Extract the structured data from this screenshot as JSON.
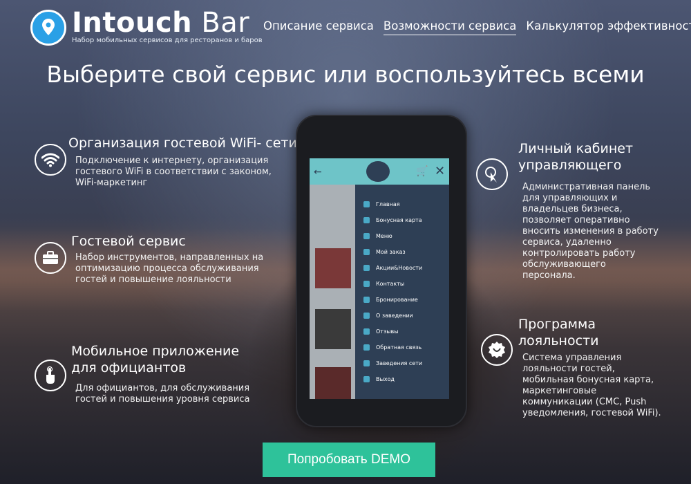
{
  "header": {
    "logo_bold": "Intouch",
    "logo_light": " Bar",
    "logo_subtitle": "Набор мобильных сервисов для ресторанов и баров",
    "nav": [
      {
        "label": "Описание сервиса"
      },
      {
        "label": "Возможности сервиса"
      },
      {
        "label": "Калькулятор эффективности"
      }
    ]
  },
  "headline": "Выберите свой сервис или воспользуйтесь всеми",
  "features_left": [
    {
      "title": "Организация гостевой WiFi- сети",
      "desc": "Подключение к интернету, организация гостевого WiFi в соответствии с законом, WiFi-маркетинг",
      "icon": "wifi-icon"
    },
    {
      "title": "Гостевой сервис",
      "desc": "Набор инструментов, направленных на оптимизацию процесса обслуживания гостей и повышение лояльности",
      "icon": "briefcase-icon"
    },
    {
      "title": "Мобильное приложение для официантов",
      "desc": "Для официантов, для обслуживания гостей и повышения уровня сервиса",
      "icon": "touch-hand-icon"
    }
  ],
  "features_right": [
    {
      "title": "Личный кабинет управляющего",
      "desc": "Административная панель для управляющих и владельцев бизнеса, позволяет оперативно вносить изменения в работу сервиса, удаленно контролировать работу обслуживающего персонала.",
      "icon": "pointer-click-icon"
    },
    {
      "title": "Программа лояльности",
      "desc": "Система управления лояльности гостей, мобильная бонусная карта, маркетинговые коммуникации (СМС, Push уведомления, гостевой WiFi).",
      "icon": "badge-icon"
    }
  ],
  "phone_menu": [
    {
      "label": "Главная"
    },
    {
      "label": "Бонусная карта"
    },
    {
      "label": "Меню"
    },
    {
      "label": "Мой заказ"
    },
    {
      "label": "Акции&Новости"
    },
    {
      "label": "Контакты"
    },
    {
      "label": "Бронирование"
    },
    {
      "label": "О заведении"
    },
    {
      "label": "Отзывы"
    },
    {
      "label": "Обратная связь"
    },
    {
      "label": "Заведения сети"
    },
    {
      "label": "Выход"
    }
  ],
  "cta": {
    "label": "Попробовать DEMO"
  },
  "colors": {
    "accent": "#2ec29a",
    "logo_blue": "#2aa0e6",
    "menu_bg": "#2e3f55",
    "app_bar": "#6ec4c8"
  }
}
